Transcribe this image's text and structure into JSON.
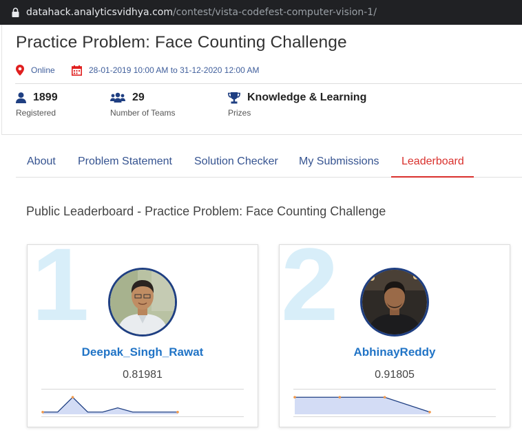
{
  "browser": {
    "url_host": "datahack.analyticsvidhya.com",
    "url_path": "/contest/vista-codefest-computer-vision-1/"
  },
  "contest": {
    "title": "Practice Problem: Face Counting Challenge",
    "location": "Online",
    "dates": "28-01-2019 10:00 AM to 31-12-2020 12:00 AM"
  },
  "stats": [
    {
      "value": "1899",
      "label": "Registered",
      "icon": "user-icon"
    },
    {
      "value": "29",
      "label": "Number of Teams",
      "icon": "team-icon"
    },
    {
      "value": "Knowledge & Learning",
      "label": "Prizes",
      "icon": "trophy-icon"
    }
  ],
  "tabs": [
    {
      "label": "About",
      "active": false
    },
    {
      "label": "Problem Statement",
      "active": false
    },
    {
      "label": "Solution Checker",
      "active": false
    },
    {
      "label": "My Submissions",
      "active": false
    },
    {
      "label": "Leaderboard",
      "active": true
    }
  ],
  "leaderboard": {
    "heading": "Public Leaderboard - Practice Problem: Face Counting Challenge",
    "entries": [
      {
        "rank": "1",
        "username": "Deepak_Singh_Rawat",
        "score": "0.81981",
        "trend": [
          0.79,
          0.79,
          0.86,
          0.79,
          0.79,
          0.81,
          0.79,
          0.79,
          0.79,
          0.79
        ]
      },
      {
        "rank": "2",
        "username": "AbhinayReddy",
        "score": "0.91805",
        "trend": [
          0.93,
          0.93,
          0.93,
          0.915
        ]
      }
    ]
  },
  "colors": {
    "accent_red": "#d9302c",
    "link_blue": "#2174c6",
    "nav_blue": "#355390",
    "rank_watermark": "#d8eef9"
  }
}
